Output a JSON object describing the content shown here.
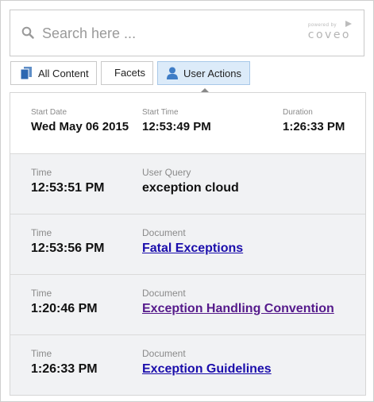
{
  "search": {
    "placeholder": "Search here ...",
    "powered_by": "powered by",
    "brand": "coveo"
  },
  "tabs": [
    {
      "label": "All Content",
      "icon": "documents-icon",
      "selected": false
    },
    {
      "label": "Facets",
      "selected": false
    },
    {
      "label": "User Actions",
      "icon": "user-icon",
      "selected": true
    }
  ],
  "session": {
    "start_date_label": "Start Date",
    "start_date": "Wed May 06 2015",
    "start_time_label": "Start Time",
    "start_time": "12:53:49 PM",
    "duration_label": "Duration",
    "duration": "1:26:33 PM"
  },
  "actions": [
    {
      "time_label": "Time",
      "time": "12:53:51 PM",
      "type_label": "User Query",
      "value": "exception cloud",
      "is_link": false
    },
    {
      "time_label": "Time",
      "time": "12:53:56 PM",
      "type_label": "Document",
      "value": "Fatal Exceptions",
      "is_link": true,
      "visited": false
    },
    {
      "time_label": "Time",
      "time": "1:20:46 PM",
      "type_label": "Document",
      "value": "Exception Handling Convention",
      "is_link": true,
      "visited": true
    },
    {
      "time_label": "Time",
      "time": "1:26:33 PM",
      "type_label": "Document",
      "value": "Exception Guidelines",
      "is_link": true,
      "visited": false
    }
  ],
  "colors": {
    "selected_tab_bg": "#dcebf9",
    "link": "#1a0dab",
    "visited_link": "#551a8b",
    "panel_bg": "#f1f2f4"
  }
}
